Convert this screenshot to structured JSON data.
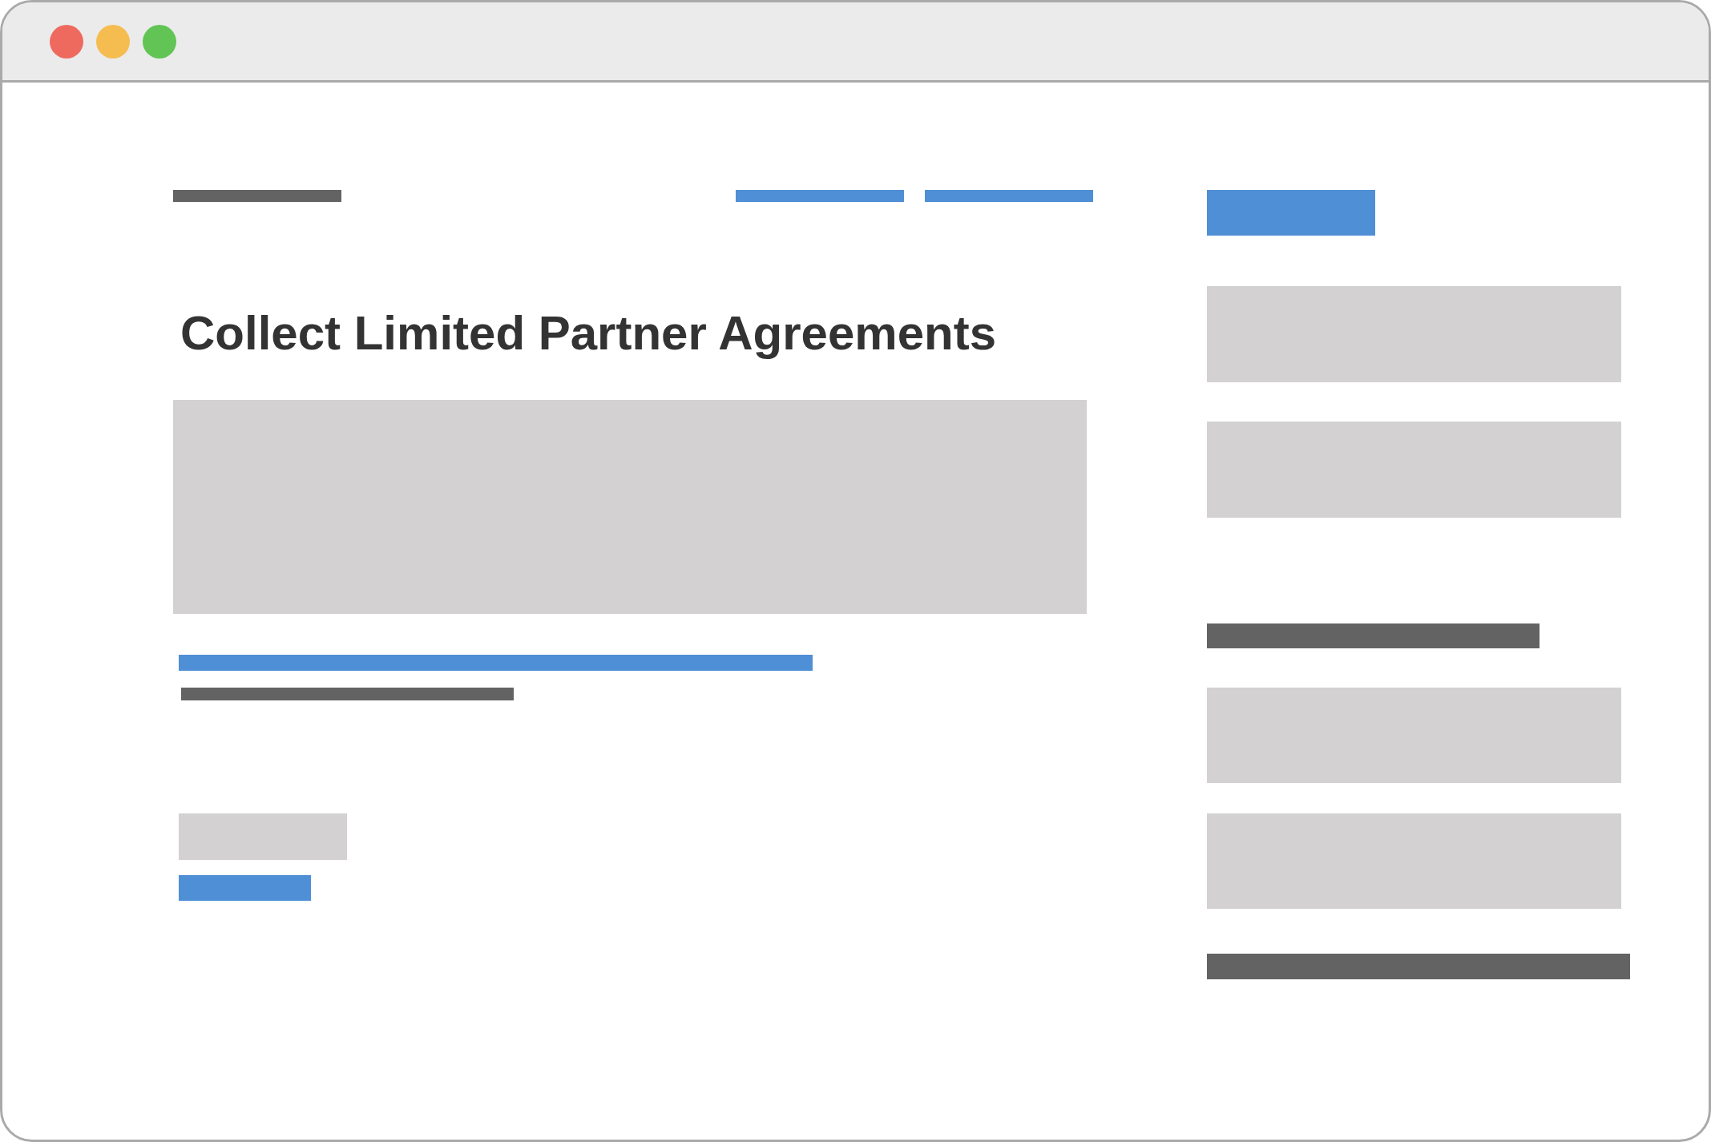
{
  "window_controls": [
    {
      "kind": "close"
    },
    {
      "kind": "minimize"
    },
    {
      "kind": "zoom"
    }
  ],
  "nav": [
    {
      "kind": "text"
    },
    {
      "kind": "link"
    },
    {
      "kind": "link"
    }
  ],
  "heading": "Collect Limited Partner Agreements",
  "content": [
    {
      "kind": "image"
    },
    {
      "kind": "link"
    },
    {
      "kind": "text"
    },
    {
      "kind": "image"
    },
    {
      "kind": "link"
    }
  ],
  "sidebar": [
    {
      "kind": "link"
    },
    {
      "kind": "image"
    },
    {
      "kind": "image"
    },
    {
      "kind": "text"
    },
    {
      "kind": "image"
    },
    {
      "kind": "image"
    },
    {
      "kind": "text"
    }
  ]
}
